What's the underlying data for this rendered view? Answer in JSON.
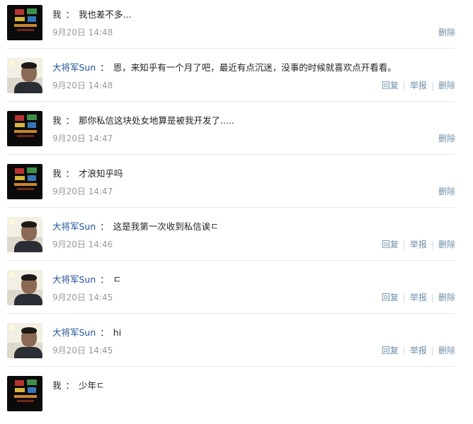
{
  "messages": [
    {
      "who": "me",
      "author": "我",
      "sep": "：",
      "text": "我也差不多...",
      "time": "9月20日 14:48"
    },
    {
      "who": "sun",
      "author": "大将军Sun",
      "sep": "：",
      "text": "恩，来知乎有一个月了吧，最近有点沉迷，没事的时候就喜欢点开看看。",
      "time": "9月20日 14:48"
    },
    {
      "who": "me",
      "author": "我",
      "sep": "：",
      "text": "那你私信这块处女地算是被我开发了.....",
      "time": "9月20日 14:47"
    },
    {
      "who": "me",
      "author": "我",
      "sep": "：",
      "text": "才浪知乎吗",
      "time": "9月20日 14:47"
    },
    {
      "who": "sun",
      "author": "大将军Sun",
      "sep": "：",
      "text": "这是我第一次收到私信诶ㄷ",
      "time": "9月20日 14:46"
    },
    {
      "who": "sun",
      "author": "大将军Sun",
      "sep": "：",
      "text": "ㄷ",
      "time": "9月20日 14:45"
    },
    {
      "who": "sun",
      "author": "大将军Sun",
      "sep": "：",
      "text": "hi",
      "time": "9月20日 14:45"
    },
    {
      "who": "me",
      "author": "我",
      "sep": "：",
      "text": "少年ㄷ",
      "time": ""
    }
  ],
  "actions": {
    "reply": "回复",
    "report": "举报",
    "delete": "删除",
    "sep": "|"
  }
}
